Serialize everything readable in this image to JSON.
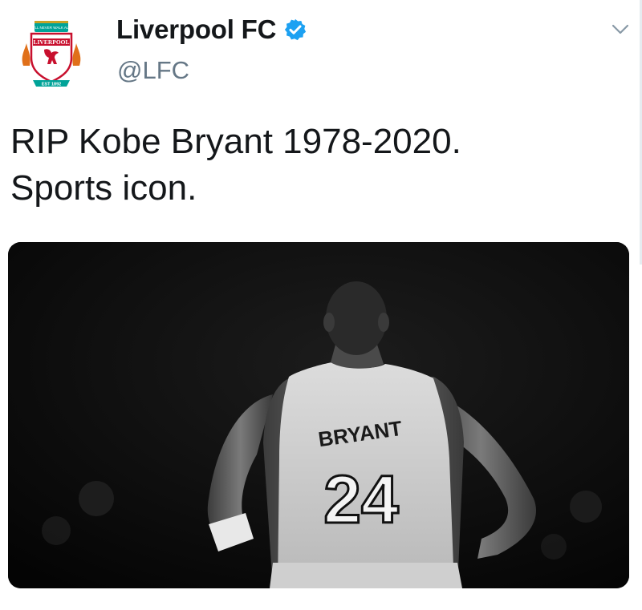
{
  "tweet": {
    "display_name": "Liverpool FC",
    "handle": "@LFC",
    "verified": true,
    "text_line1": "RIP Kobe Bryant 1978-2020.",
    "text_line2": "Sports icon."
  },
  "avatar": {
    "crest_name": "LIVERPOOL",
    "crest_motto": "YOU'LL NEVER WALK ALONE",
    "crest_est": "EST 1892"
  },
  "media": {
    "jersey_name": "BRYANT",
    "jersey_number": "24"
  },
  "icons": {
    "verified": "verified-badge-icon",
    "menu": "chevron-down-icon"
  },
  "colors": {
    "verified_blue": "#1da1f2",
    "handle_gray": "#657786",
    "crest_red": "#c8102e",
    "crest_green": "#00a398"
  }
}
